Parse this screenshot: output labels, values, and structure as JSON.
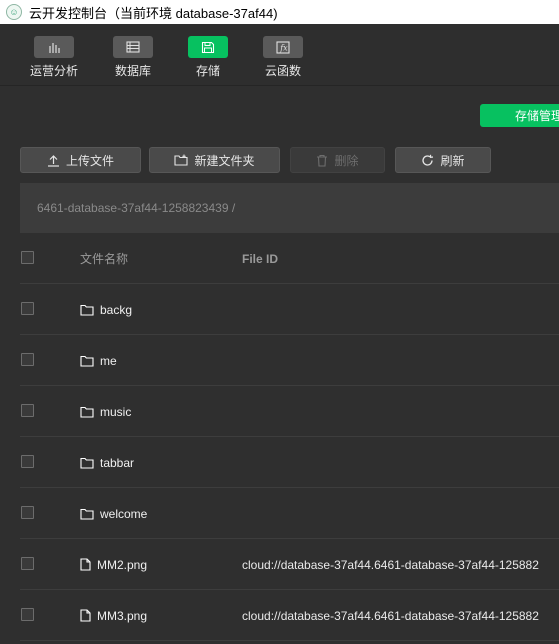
{
  "window": {
    "title": "云开发控制台（当前环境 database-37af44)"
  },
  "toolbar": {
    "items": [
      {
        "label": "运营分析",
        "icon": "bar-chart-icon"
      },
      {
        "label": "数据库",
        "icon": "database-icon"
      },
      {
        "label": "存储",
        "icon": "storage-icon",
        "active": true
      },
      {
        "label": "云函数",
        "icon": "function-icon"
      }
    ]
  },
  "storage": {
    "manage_label": "存储管理",
    "actions": {
      "upload": "上传文件",
      "new_folder": "新建文件夹",
      "delete": "删除",
      "refresh": "刷新"
    },
    "path": "6461-database-37af44-1258823439 /",
    "columns": {
      "name": "文件名称",
      "file_id": "File ID"
    },
    "rows": [
      {
        "type": "folder",
        "name": "backg",
        "file_id": ""
      },
      {
        "type": "folder",
        "name": "me",
        "file_id": ""
      },
      {
        "type": "folder",
        "name": "music",
        "file_id": ""
      },
      {
        "type": "folder",
        "name": "tabbar",
        "file_id": ""
      },
      {
        "type": "folder",
        "name": "welcome",
        "file_id": ""
      },
      {
        "type": "file",
        "name": "MM2.png",
        "file_id": "cloud://database-37af44.6461-database-37af44-125882"
      },
      {
        "type": "file",
        "name": "MM3.png",
        "file_id": "cloud://database-37af44.6461-database-37af44-125882"
      }
    ]
  },
  "colors": {
    "accent": "#07c160",
    "background": "#2f2f2f",
    "toolbar": "#2e2e2e"
  }
}
